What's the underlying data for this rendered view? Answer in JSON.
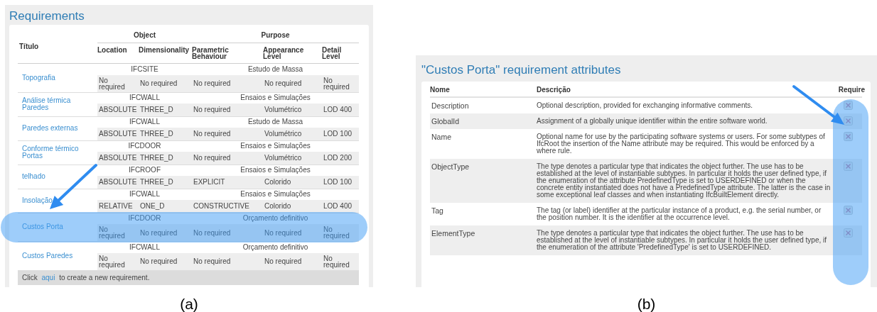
{
  "panel_a": {
    "title": "Requirements",
    "table": {
      "group_headers": [
        "Object",
        "Purpose"
      ],
      "columns": [
        "Título",
        "Location",
        "Dimensionality",
        "Parametric Behaviour",
        "Appearance Level",
        "Detail Level"
      ],
      "rows": [
        {
          "title": "Topografia",
          "entity": "IFCSITE",
          "purpose": "Estudo de Massa",
          "values": [
            "No required",
            "No required",
            "No required",
            "No required",
            "No required"
          ],
          "highlighted": false
        },
        {
          "title": "Análise térmica Paredes",
          "entity": "IFCWALL",
          "purpose": "Ensaios e Simulações",
          "values": [
            "ABSOLUTE",
            "THREE_D",
            "No required",
            "Volumétrico",
            "LOD 400"
          ],
          "highlighted": false
        },
        {
          "title": "Paredes externas",
          "entity": "IFCWALL",
          "purpose": "Estudo de Massa",
          "values": [
            "ABSOLUTE",
            "THREE_D",
            "No required",
            "Volumétrico",
            "LOD 100"
          ],
          "highlighted": false
        },
        {
          "title": "Conforme térmico Portas",
          "entity": "IFCDOOR",
          "purpose": "Ensaios e Simulações",
          "values": [
            "ABSOLUTE",
            "THREE_D",
            "No required",
            "Volumétrico",
            "LOD 200"
          ],
          "highlighted": false
        },
        {
          "title": "telhado",
          "entity": "IFCROOF",
          "purpose": "Ensaios e Simulações",
          "values": [
            "ABSOLUTE",
            "THREE_D",
            "EXPLICIT",
            "Colorido",
            "LOD 100"
          ],
          "highlighted": false
        },
        {
          "title": "Insolação",
          "entity": "IFCWALL",
          "purpose": "Ensaios e Simulações",
          "values": [
            "RELATIVE",
            "ONE_D",
            "CONSTRUCTIVE",
            "Colorido",
            "LOD 400"
          ],
          "highlighted": false
        },
        {
          "title": "Custos Porta",
          "entity": "IFCDOOR",
          "purpose": "Orçamento definitivo",
          "values": [
            "No required",
            "No required",
            "No required",
            "No required",
            "No required"
          ],
          "highlighted": true
        },
        {
          "title": "Custos Paredes",
          "entity": "IFCWALL",
          "purpose": "Orçamento definitivo",
          "values": [
            "No required",
            "No required",
            "No required",
            "No required",
            "No required"
          ],
          "highlighted": false
        }
      ]
    },
    "footer": {
      "before": "Click",
      "link": "aqui",
      "after": "to create a new requirement."
    },
    "caption": "(a)"
  },
  "panel_b": {
    "title": "\"Custos Porta\" requirement attributes",
    "columns": [
      "Nome",
      "Descrição",
      "Require"
    ],
    "attributes": [
      {
        "name": "Description",
        "description": "Optional description, provided for exchanging informative comments.",
        "required": false
      },
      {
        "name": "GlobalId",
        "description": "Assignment of a globally unique identifier within the entire software world.",
        "required": false
      },
      {
        "name": "Name",
        "description": "Optional name for use by the participating software systems or users. For some subtypes of IfcRoot the insertion of the Name attribute may be required. This would be enforced by a where rule.",
        "required": false
      },
      {
        "name": "ObjectType",
        "description": "The type denotes a particular type that indicates the object further. The use has to be established at the level of instantiable subtypes. In particular it holds the user defined type, if the enumeration of the attribute PredefinedType is set to USERDEFINED or when the concrete entity instantiated does not have a PredefinedType attribute. The latter is the case in some exceptional leaf classes and when instantiating IfcBuiltElement directly.",
        "required": false
      },
      {
        "name": "Tag",
        "description": "The tag (or label) identifier at the particular instance of a product, e.g. the serial number, or the position number. It is the identifier at the occurrence level.",
        "required": false
      },
      {
        "name": "ElementType",
        "description": "The type denotes a particular type that indicates the object further. The use has to be established at the level of instantiable subtypes. In particular it holds the user defined type, if the enumeration of the attribute 'PredefinedType' is set to USERDEFINED.",
        "required": false
      }
    ],
    "caption": "(b)"
  }
}
